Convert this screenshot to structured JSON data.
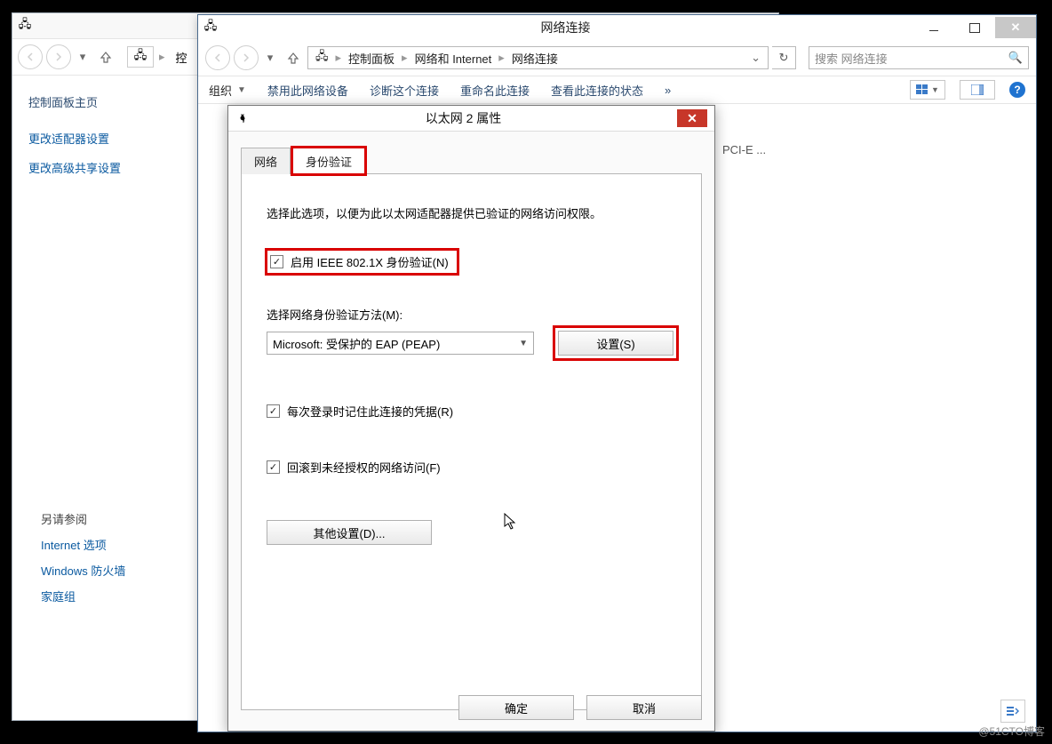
{
  "backWindow": {
    "breadcrumb_partial": "控"
  },
  "controlPanel": {
    "heading": "控制面板主页",
    "link_adapter": "更改适配器设置",
    "link_sharing": "更改高级共享设置",
    "see_also": "另请参阅",
    "see_internet": "Internet 选项",
    "see_firewall": "Windows 防火墙",
    "see_homegroup": "家庭组"
  },
  "explorer": {
    "title": "网络连接",
    "breadcrumb": {
      "seg1": "控制面板",
      "seg2": "网络和 Internet",
      "seg3": "网络连接"
    },
    "search_placeholder": "搜索 网络连接",
    "toolbar": {
      "organize": "组织",
      "disable": "禁用此网络设备",
      "diagnose": "诊断这个连接",
      "rename": "重命名此连接",
      "status": "查看此连接的状态",
      "overflow": "»"
    },
    "adapter_tail": "PCI-E ..."
  },
  "dialog": {
    "title": "以太网 2 属性",
    "tab_network": "网络",
    "tab_auth": "身份验证",
    "intro": "选择此选项，以便为此以太网适配器提供已验证的网络访问权限。",
    "enable_8021x": "启用 IEEE 802.1X 身份验证(N)",
    "method_label": "选择网络身份验证方法(M):",
    "method_value": "Microsoft: 受保护的 EAP (PEAP)",
    "settings_btn": "设置(S)",
    "remember": "每次登录时记住此连接的凭据(R)",
    "fallback": "回滚到未经授权的网络访问(F)",
    "additional_btn": "其他设置(D)...",
    "ok": "确定",
    "cancel": "取消"
  },
  "watermark": "@51CTO博客"
}
